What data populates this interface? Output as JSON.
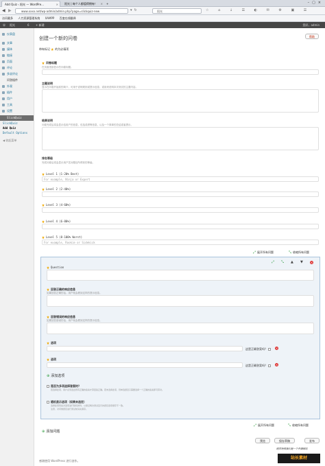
{
  "browser": {
    "tabs": [
      {
        "label": "Add Quiz ‹ 阳光 — WordPre..."
      },
      {
        "label": "阳光 | 每个人都值得拥有！"
      }
    ],
    "url": "www.xxxx.net/wp-admin/admin.php?page=slickquiz-new",
    "search_value": "阳光",
    "bookmarks": [
      "访问最多",
      "人力资源管理系统",
      "XAMPP",
      "百度在线翻译"
    ]
  },
  "adminbar": {
    "site": "阳光",
    "left_items": [
      "6",
      "新建"
    ],
    "greeting": "您好，admin"
  },
  "sidebar": {
    "items": [
      "仪表盘",
      "文章",
      "媒体",
      "链接",
      "页面",
      "评论",
      "外观",
      "插件",
      "用户",
      "工具",
      "设置"
    ],
    "active_sub": "多说评论",
    "active_sub2": "问答插件",
    "plugin_head": "SlickQuiz",
    "plugin_subs": [
      "SlickQuiz",
      "Add Quiz",
      "Default Options"
    ],
    "collapse": "收起菜单"
  },
  "page": {
    "title": "创建一个新的问卷",
    "help": "帮助",
    "required_note": "带有标记",
    "required_note2": "的为必填项",
    "quiz_name_label": "问卷标题",
    "quiz_name_desc": "在页面顶部显示的问卷标题。",
    "main_desc_label": "主题说明",
    "main_desc_desc": "显示在问卷开始前的简介，可用于说明规则或提示信息，或用来说明本次测试的主要内容。",
    "result_desc_label": "结果说明",
    "result_desc_desc": "问卷完成后将会显示给用户的信息，包括成绩等信息，以及一个简单的总结或者提示。",
    "ranking_label": "排名等级",
    "ranking_desc": "完成问卷后将会显示用户答对题目所得到的等级。",
    "levels": [
      {
        "label": "Level 1 (1-20% Best)",
        "placeholder": "For example, Ninja or Expert"
      },
      {
        "label": "Level 2 (2-40%)",
        "placeholder": ""
      },
      {
        "label": "Level 3 (4-60%)",
        "placeholder": ""
      },
      {
        "label": "Level 4 (6-80%)",
        "placeholder": ""
      },
      {
        "label": "Level 5 (8-100% Worst)",
        "placeholder": "For example, Rookie or Sidekick"
      }
    ],
    "expand_all": "展开所有问题",
    "collapse_all": "收缩所有问题",
    "question": {
      "question_label": "Question",
      "correct_label": "回答正确的响应信息",
      "correct_desc": "如果回答正确的话，用户就会看到这样的提示信息。",
      "incorrect_label": "回答错误的响应信息",
      "incorrect_desc": "如果回答错误的话，用户就会看到这样的提示信息。",
      "answer_label": "选项",
      "correct_check": "这是正确答案吗？",
      "add_answer": "添加选项",
      "opt1_label": "是否为多项选择答案时？",
      "opt1_desc": "若选择此项，用户必须选出所有正确的答案才算回答正确。若未选择此项，则单选题目只需要选择一个正确的答案即可算对。",
      "opt2_label": "随机显示选项（如果未选定）",
      "opt2_desc1": "选择此项则会对选项进行随机排列，以保证每次测试显示的题目选项顺序不一致。",
      "opt2_desc2": "注意，对问卷题目进行测试前请先保存。"
    },
    "add_question": "添加问题",
    "btn_preview": "预览",
    "btn_save_draft": "保存草稿",
    "btn_publish": "发布",
    "footer": "感谢使用 WordPress 进行创作。"
  },
  "watermark": {
    "slogan": "网页特效我们是一个开源网站",
    "brand": "站长素材"
  },
  "colors": {
    "accent": "#21759b",
    "admin_bar": "#464646",
    "star": "#f0a800"
  }
}
